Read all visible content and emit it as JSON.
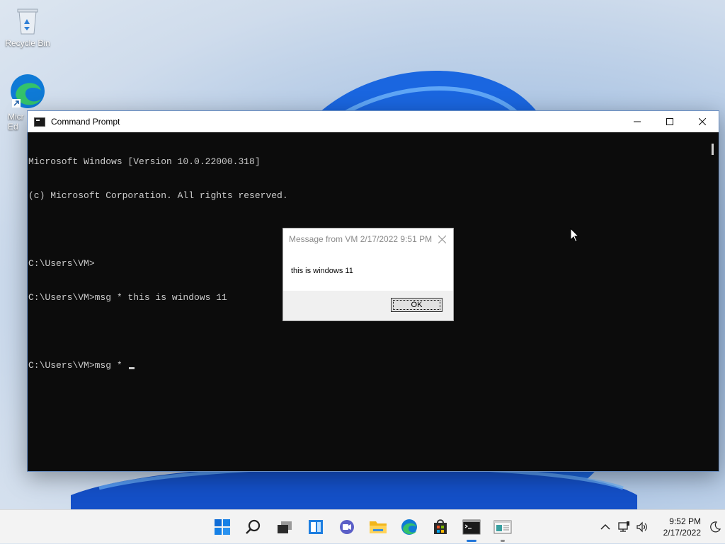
{
  "desktop": {
    "icons": [
      {
        "label": "Recycle Bin",
        "icon": "recycle-bin-icon"
      },
      {
        "label": "Micr\nEd",
        "icon": "edge-shortcut-icon"
      }
    ]
  },
  "cmd_window": {
    "title": "Command Prompt",
    "buttons": {
      "minimize": "—",
      "maximize": "☐",
      "close": "✕"
    },
    "lines": [
      "Microsoft Windows [Version 10.0.22000.318]",
      "(c) Microsoft Corporation. All rights reserved.",
      "",
      "C:\\Users\\VM>",
      "C:\\Users\\VM>msg * this is windows 11",
      "",
      "C:\\Users\\VM>msg * "
    ]
  },
  "message_box": {
    "title": "Message from VM 2/17/2022 9:51 PM",
    "text": "this is windows 11",
    "ok_label": "OK",
    "close": "✕"
  },
  "taskbar": {
    "items": [
      "start-icon",
      "search-icon",
      "task-view-icon",
      "widgets-icon",
      "chat-icon",
      "file-explorer-icon",
      "edge-icon",
      "store-icon",
      "command-prompt-icon",
      "notepad-icon"
    ],
    "tray": {
      "chevron": "^",
      "time": "9:52 PM",
      "date": "2/17/2022"
    }
  },
  "colors": {
    "console_bg": "#0c0c0c",
    "console_fg": "#cccccc",
    "accent": "#2176d9"
  }
}
